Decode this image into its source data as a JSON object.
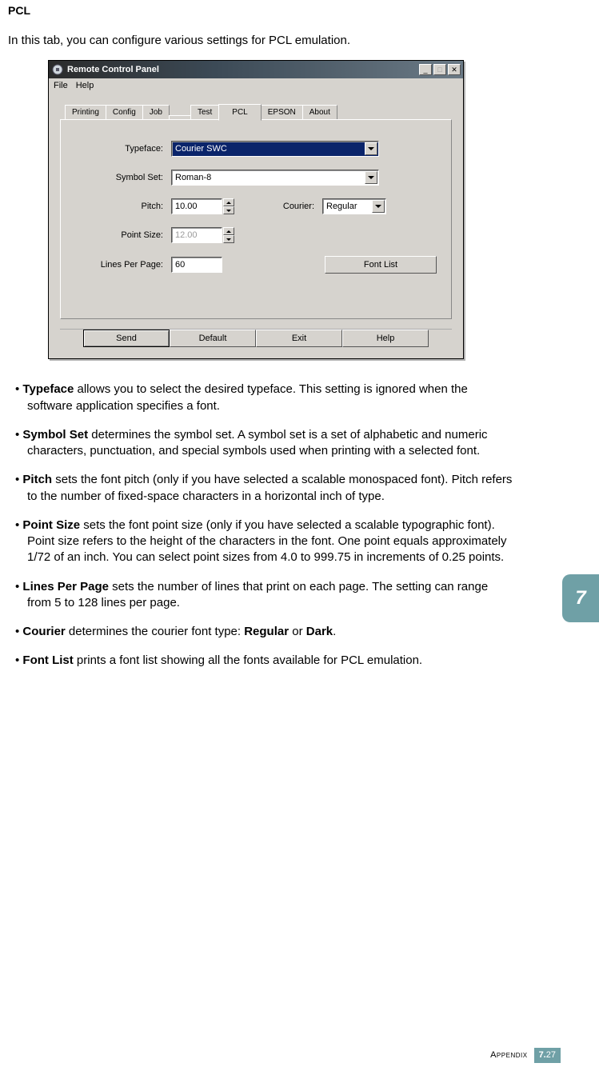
{
  "page": {
    "title": "PCL",
    "intro": "In this tab, you can configure various settings for PCL emulation."
  },
  "window": {
    "title": "Remote Control Panel",
    "menu": {
      "file": "File",
      "help": "Help"
    },
    "tabs": {
      "printing": "Printing",
      "config": "Config",
      "job": "Job",
      "test": "Test",
      "pcl": "PCL",
      "epson": "EPSON",
      "about": "About"
    },
    "labels": {
      "typeface": "Typeface:",
      "symbolset": "Symbol Set:",
      "pitch": "Pitch:",
      "courier": "Courier:",
      "pointsize": "Point Size:",
      "lpp": "Lines Per Page:"
    },
    "values": {
      "typeface": "Courier SWC",
      "symbolset": "Roman-8",
      "pitch": "10.00",
      "pointsize": "12.00",
      "lpp": "60",
      "courier": "Regular"
    },
    "buttons": {
      "fontlist": "Font List",
      "send": "Send",
      "default": "Default",
      "exit": "Exit",
      "help": "Help"
    }
  },
  "bullets": {
    "typeface": {
      "term": "Typeface",
      "text": " allows you to select the desired typeface. This setting is ignored when the software application specifies a font."
    },
    "symbolset": {
      "term": "Symbol Set",
      "text": " determines the symbol set. A symbol set is a set of alphabetic and numeric characters, punctuation, and special symbols used when printing with a selected font."
    },
    "pitch": {
      "term": "Pitch",
      "text": " sets the font pitch (only if you have selected a scalable monospaced font). Pitch refers to the number of fixed-space characters in a horizontal inch of type."
    },
    "pointsize": {
      "term": "Point Size",
      "text": " sets the font point size (only if you have selected a scalable typographic font). Point size refers to the height of the characters in the font. One point equals approximately 1/72 of an inch. You can select point sizes from 4.0 to 999.75 in increments of 0.25 points."
    },
    "lpp": {
      "term": "Lines Per Page",
      "text": " sets the number of lines that print on each page. The setting can range from 5 to 128 lines per page."
    },
    "courier": {
      "term": "Courier",
      "text_a": " determines the courier font type: ",
      "opt1": "Regular",
      "mid": " or ",
      "opt2": "Dark",
      "end": "."
    },
    "fontlist": {
      "term": "Font List",
      "text": " prints a font list showing all the fonts available for PCL emulation."
    }
  },
  "side": {
    "chapter": "7"
  },
  "footer": {
    "appendix": "Appendix",
    "major": "7.",
    "minor": "27"
  }
}
